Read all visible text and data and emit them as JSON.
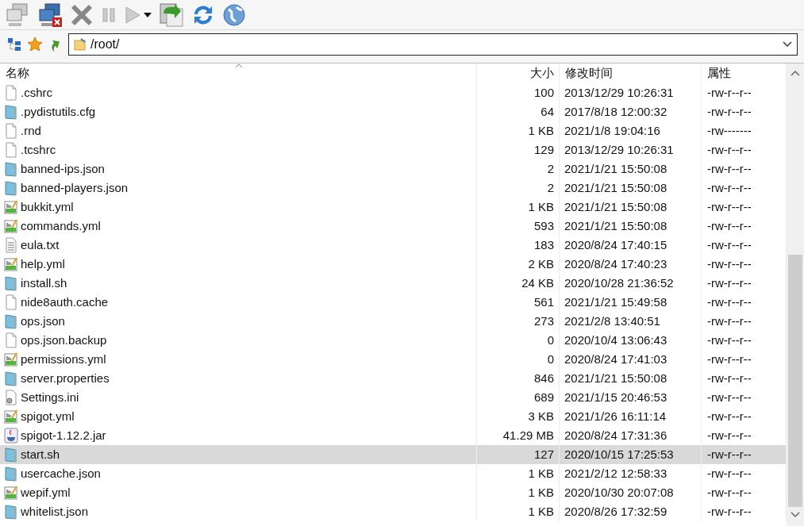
{
  "address_bar": {
    "path": "/root/"
  },
  "table": {
    "columns": [
      "名称",
      "大小",
      "修改时间",
      "属性"
    ],
    "rows": [
      {
        "name": ".cshrc",
        "size": "100",
        "modified": "2013/12/29 10:26:31",
        "attributes": "-rw-r--r--",
        "kind": "blank",
        "selected": false
      },
      {
        "name": ".pydistutils.cfg",
        "size": "64",
        "modified": "2017/8/18 12:00:32",
        "attributes": "-rw-r--r--",
        "kind": "text",
        "selected": false
      },
      {
        "name": ".rnd",
        "size": "1 KB",
        "modified": "2021/1/8 19:04:16",
        "attributes": "-rw-------",
        "kind": "blank",
        "selected": false
      },
      {
        "name": ".tcshrc",
        "size": "129",
        "modified": "2013/12/29 10:26:31",
        "attributes": "-rw-r--r--",
        "kind": "blank",
        "selected": false
      },
      {
        "name": "banned-ips.json",
        "size": "2",
        "modified": "2021/1/21 15:50:08",
        "attributes": "-rw-r--r--",
        "kind": "text",
        "selected": false
      },
      {
        "name": "banned-players.json",
        "size": "2",
        "modified": "2021/1/21 15:50:08",
        "attributes": "-rw-r--r--",
        "kind": "text",
        "selected": false
      },
      {
        "name": "bukkit.yml",
        "size": "1 KB",
        "modified": "2021/1/21 15:50:08",
        "attributes": "-rw-r--r--",
        "kind": "yml",
        "selected": false
      },
      {
        "name": "commands.yml",
        "size": "593",
        "modified": "2021/1/21 15:50:08",
        "attributes": "-rw-r--r--",
        "kind": "yml",
        "selected": false
      },
      {
        "name": "eula.txt",
        "size": "183",
        "modified": "2020/8/24 17:40:15",
        "attributes": "-rw-r--r--",
        "kind": "lines",
        "selected": false
      },
      {
        "name": "help.yml",
        "size": "2 KB",
        "modified": "2020/8/24 17:40:23",
        "attributes": "-rw-r--r--",
        "kind": "yml",
        "selected": false
      },
      {
        "name": "install.sh",
        "size": "24 KB",
        "modified": "2020/10/28 21:36:52",
        "attributes": "-rw-r--r--",
        "kind": "text",
        "selected": false
      },
      {
        "name": "nide8auth.cache",
        "size": "561",
        "modified": "2021/1/21 15:49:58",
        "attributes": "-rw-r--r--",
        "kind": "blank",
        "selected": false
      },
      {
        "name": "ops.json",
        "size": "273",
        "modified": "2021/2/8 13:40:51",
        "attributes": "-rw-r--r--",
        "kind": "text",
        "selected": false
      },
      {
        "name": "ops.json.backup",
        "size": "0",
        "modified": "2020/10/4 13:06:43",
        "attributes": "-rw-r--r--",
        "kind": "blank",
        "selected": false
      },
      {
        "name": "permissions.yml",
        "size": "0",
        "modified": "2020/8/24 17:41:03",
        "attributes": "-rw-r--r--",
        "kind": "yml",
        "selected": false
      },
      {
        "name": "server.properties",
        "size": "846",
        "modified": "2021/1/21 15:50:08",
        "attributes": "-rw-r--r--",
        "kind": "text",
        "selected": false
      },
      {
        "name": "Settings.ini",
        "size": "689",
        "modified": "2021/1/15 20:46:53",
        "attributes": "-rw-r--r--",
        "kind": "settings",
        "selected": false
      },
      {
        "name": "spigot.yml",
        "size": "3 KB",
        "modified": "2021/1/26 16:11:14",
        "attributes": "-rw-r--r--",
        "kind": "yml",
        "selected": false
      },
      {
        "name": "spigot-1.12.2.jar",
        "size": "41.29 MB",
        "modified": "2020/8/24 17:31:36",
        "attributes": "-rw-r--r--",
        "kind": "java",
        "selected": false
      },
      {
        "name": "start.sh",
        "size": "127",
        "modified": "2020/10/15 17:25:53",
        "attributes": "-rw-r--r--",
        "kind": "text",
        "selected": true
      },
      {
        "name": "usercache.json",
        "size": "1 KB",
        "modified": "2021/2/12 12:58:33",
        "attributes": "-rw-r--r--",
        "kind": "text",
        "selected": false
      },
      {
        "name": "wepif.yml",
        "size": "1 KB",
        "modified": "2020/10/30 20:07:08",
        "attributes": "-rw-r--r--",
        "kind": "yml",
        "selected": false
      },
      {
        "name": "whitelist.json",
        "size": "1 KB",
        "modified": "2020/8/26 17:32:59",
        "attributes": "-rw-r--r--",
        "kind": "text",
        "selected": false
      }
    ]
  }
}
